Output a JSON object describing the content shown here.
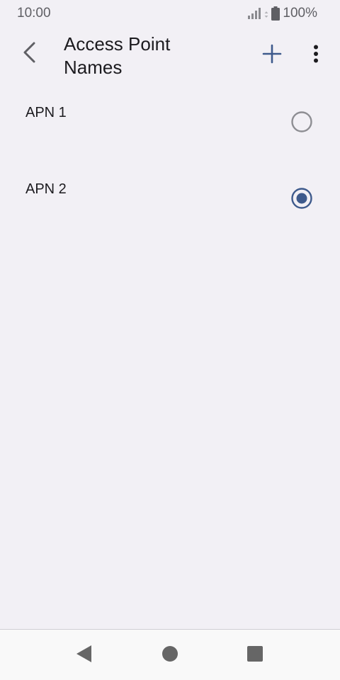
{
  "status_bar": {
    "time": "10:00",
    "battery": "100%",
    "icons": [
      "signal-icon",
      "data-arrows-icon",
      "battery-icon"
    ]
  },
  "app_bar": {
    "title": "Access Point Names",
    "icons": [
      "back-arrow-icon",
      "plus-icon",
      "more-vert-icon"
    ]
  },
  "apn_list": {
    "items": [
      {
        "label": "APN 1",
        "selected": false
      },
      {
        "label": "APN 2",
        "selected": true
      }
    ]
  },
  "nav_bar": {
    "icons": [
      "nav-back-icon",
      "nav-home-icon",
      "nav-recents-icon"
    ]
  },
  "colors": {
    "background": "#f2f0f5",
    "accent": "#3e5a8c",
    "radio_unselected": "#8e8e93",
    "nav_icon": "#666666"
  }
}
